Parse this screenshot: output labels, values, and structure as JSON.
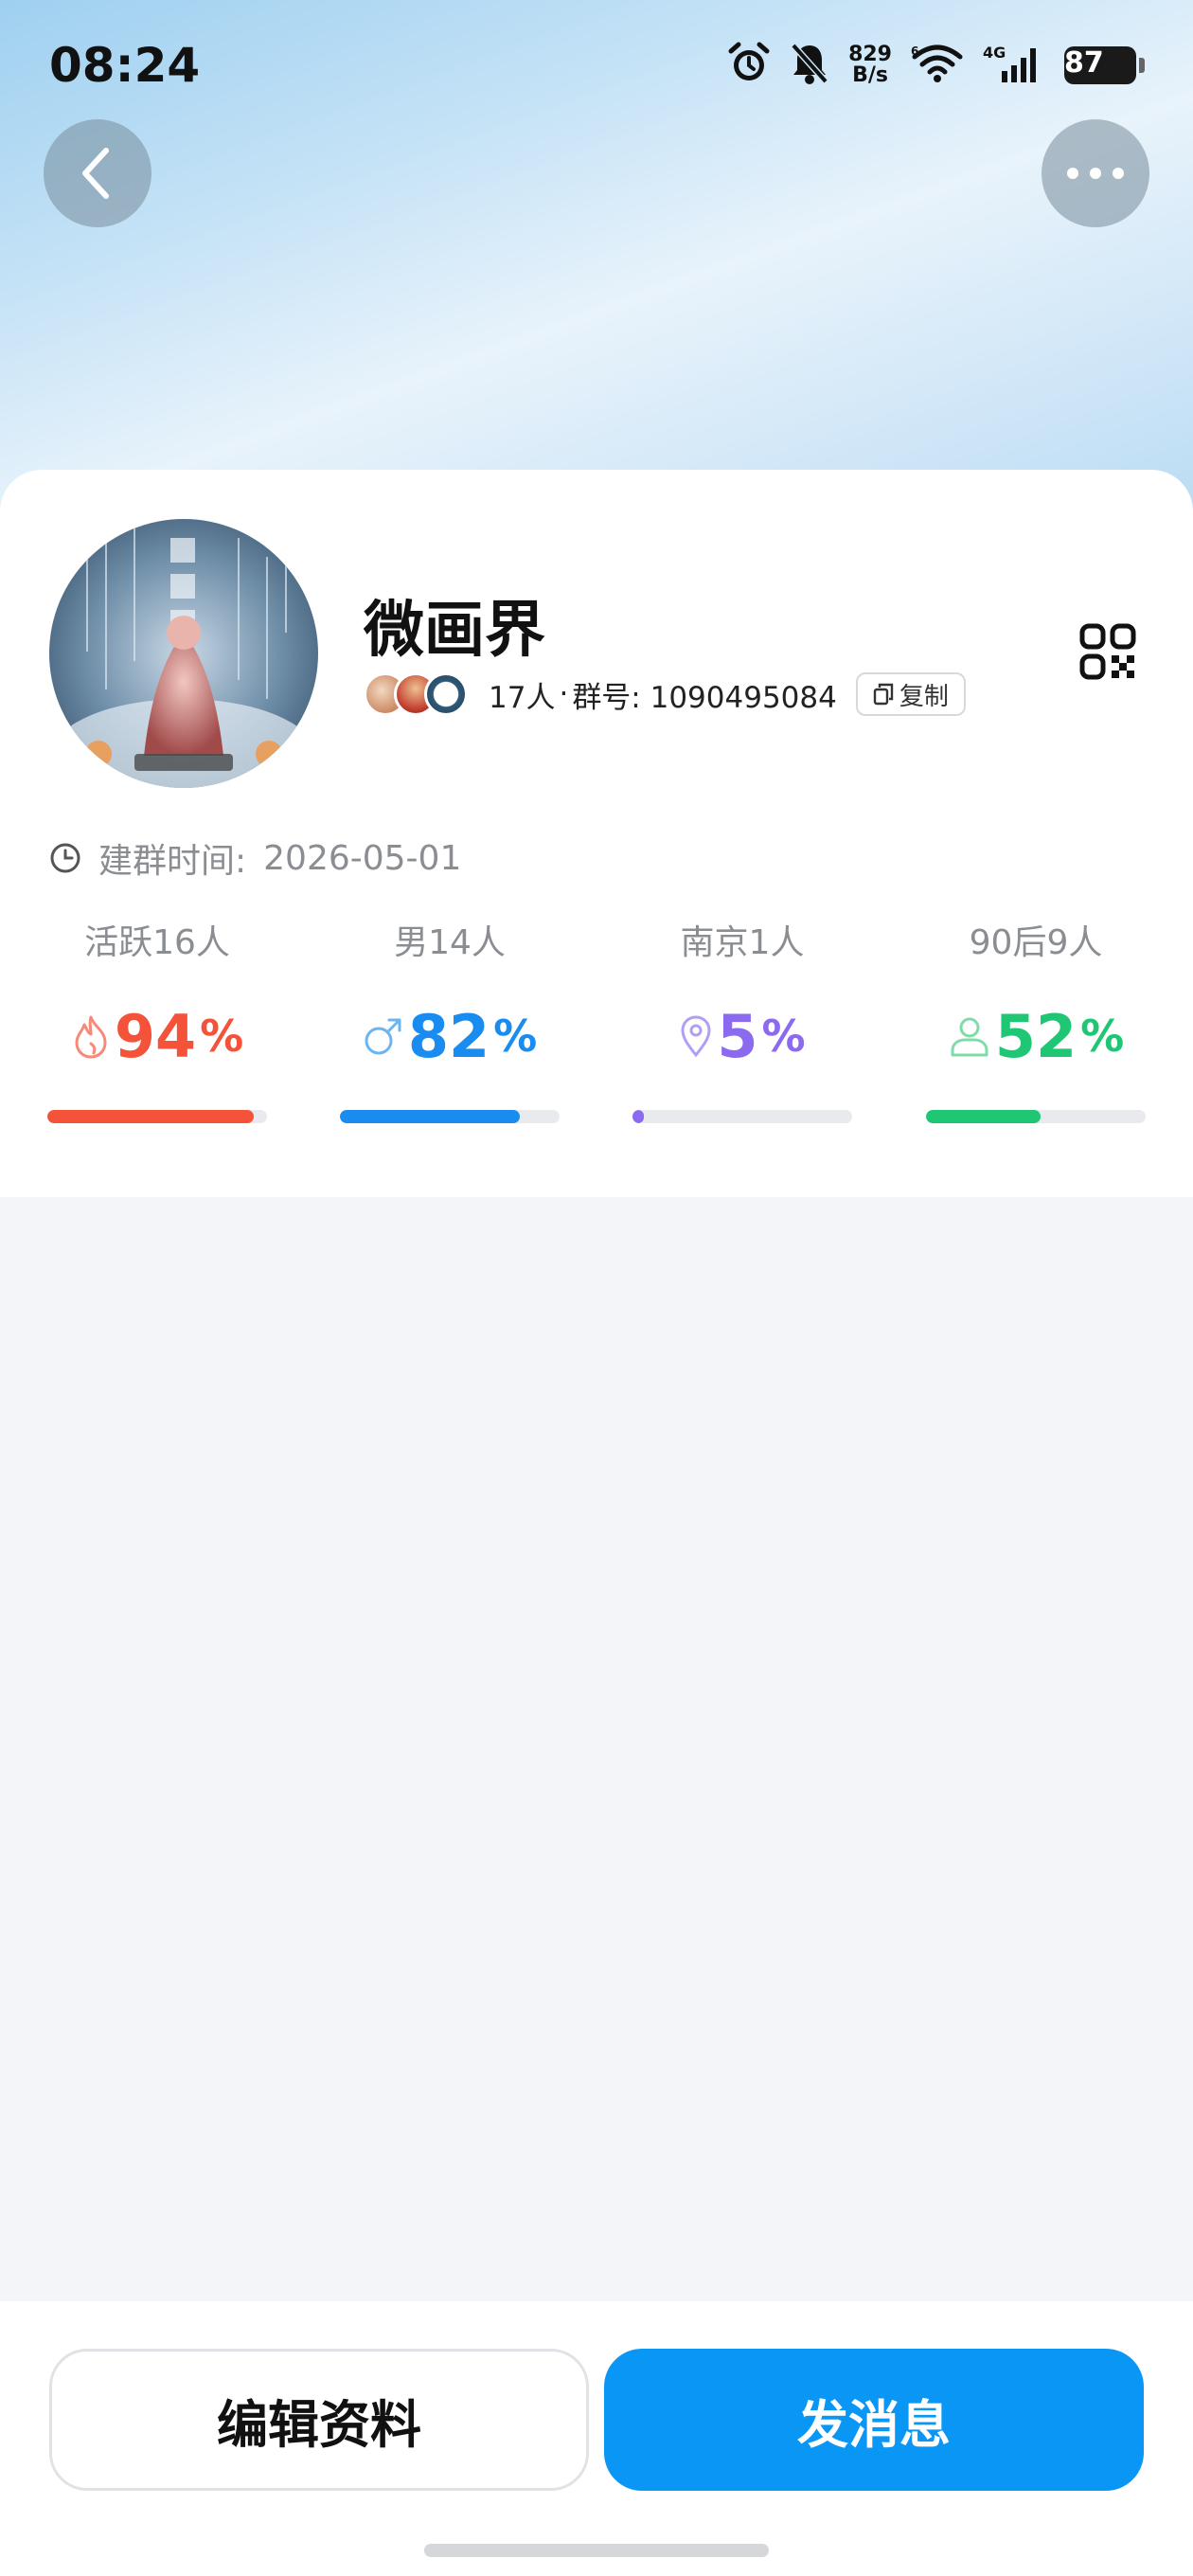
{
  "status_bar": {
    "time": "08:24",
    "net_speed_value": "829",
    "net_speed_unit": "B/s",
    "network": "4G",
    "battery": "87",
    "icons": [
      "alarm-icon",
      "mute-icon",
      "wifi-icon",
      "signal-icon",
      "battery-icon"
    ]
  },
  "nav": {
    "back_icon": "chevron-left-icon",
    "more_icon": "more-horizontal-icon"
  },
  "group": {
    "name": "微画界",
    "member_count": "17人",
    "separator": "·",
    "group_number": "群号: 1090495084",
    "copy_label": "复制",
    "created_label": "建群时间:",
    "created_date": "2026-05-01"
  },
  "stats": [
    {
      "label": "活跃16人",
      "value": "94",
      "unit": "%",
      "fill": 0.94,
      "color": "#f4533a",
      "icon": "flame-icon"
    },
    {
      "label": "男14人",
      "value": "82",
      "unit": "%",
      "fill": 0.82,
      "color": "#1a8cf0",
      "icon": "male-icon"
    },
    {
      "label": "南京1人",
      "value": "5",
      "unit": "%",
      "fill": 0.05,
      "color": "#8c6af0",
      "icon": "location-icon"
    },
    {
      "label": "90后9人",
      "value": "52",
      "unit": "%",
      "fill": 0.52,
      "color": "#1fc774",
      "icon": "person-icon"
    }
  ],
  "actions": {
    "edit_label": "编辑资料",
    "send_label": "发消息"
  },
  "colors": {
    "primary": "#0a96f5",
    "background": "#f3f5f9"
  }
}
